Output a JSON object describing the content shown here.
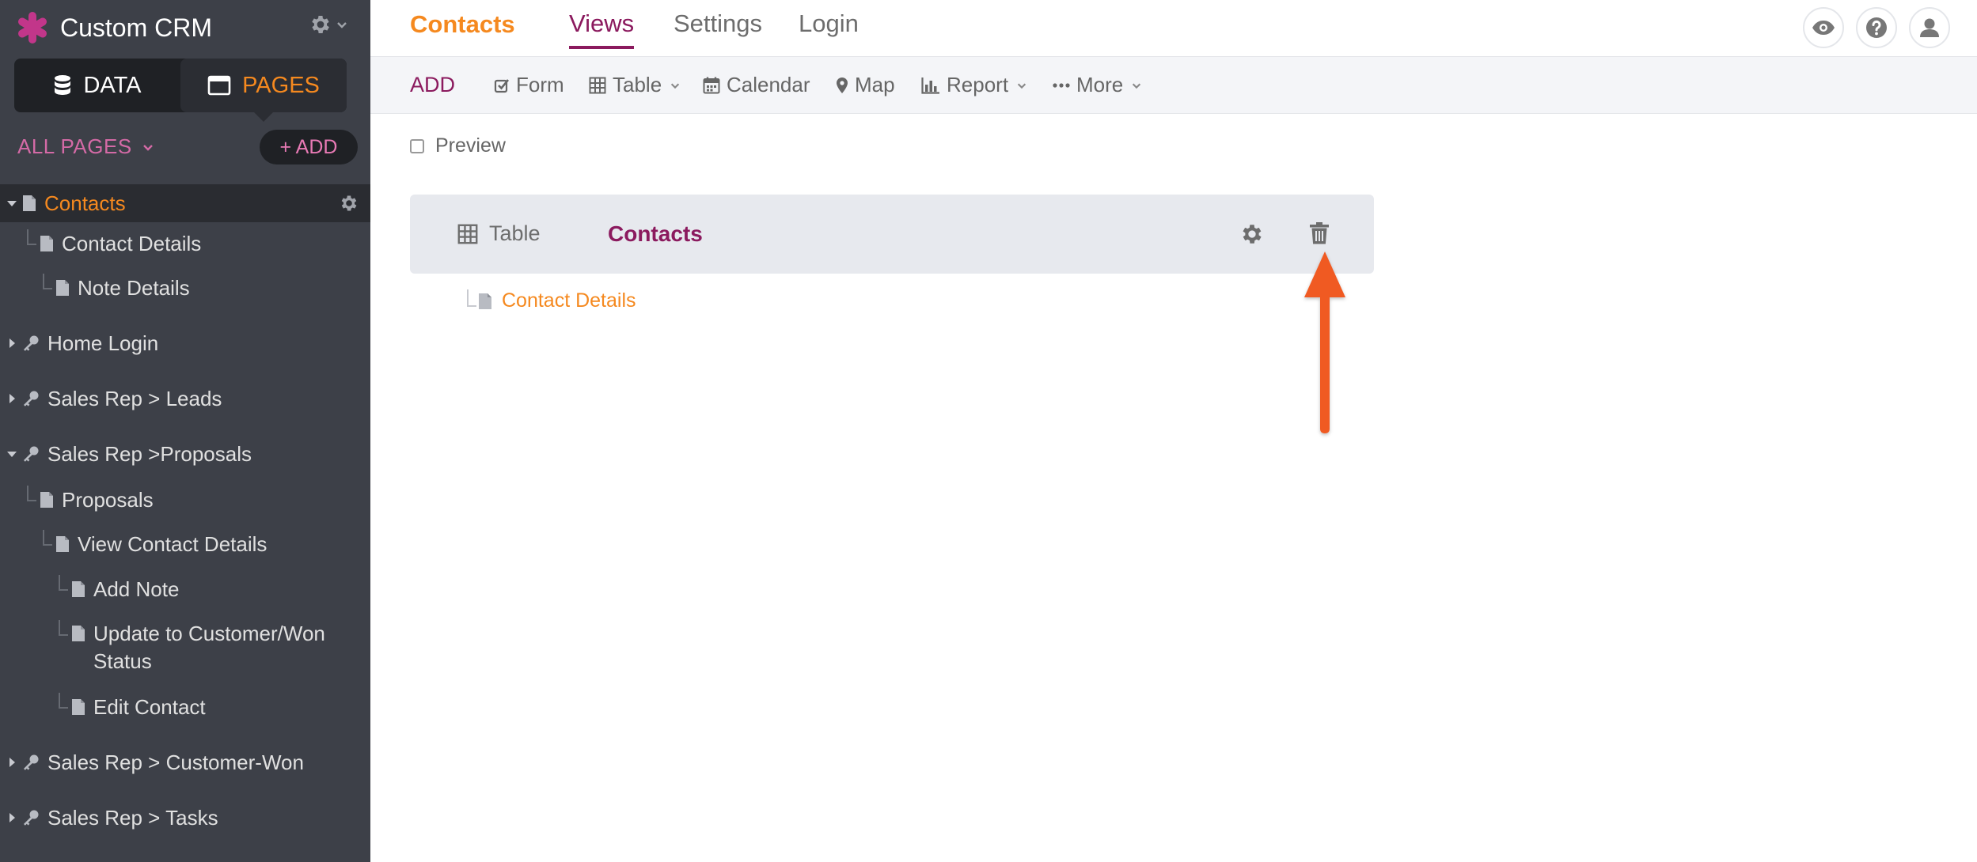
{
  "app": {
    "name": "Custom CRM"
  },
  "modes": [
    {
      "label": "DATA",
      "icon": "database-icon",
      "active": false
    },
    {
      "label": "PAGES",
      "icon": "window-icon",
      "active": true
    }
  ],
  "pages_header": {
    "filter_label": "ALL PAGES",
    "add_label": "+ ADD"
  },
  "tree": [
    {
      "label": "Contacts",
      "icon": "document-icon",
      "expanded": true,
      "selected": true
    },
    {
      "label": "Contact Details",
      "icon": "document-icon"
    },
    {
      "label": "Note Details",
      "icon": "document-icon"
    },
    {
      "label": "Home Login",
      "icon": "key-icon",
      "expanded": false
    },
    {
      "label": "Sales Rep > Leads",
      "icon": "key-icon",
      "expanded": false
    },
    {
      "label": "Sales Rep >Proposals",
      "icon": "key-icon",
      "expanded": true
    },
    {
      "label": "Proposals",
      "icon": "document-icon"
    },
    {
      "label": "View Contact Details",
      "icon": "document-icon"
    },
    {
      "label": "Add Note",
      "icon": "document-icon"
    },
    {
      "label": "Update to Customer/Won Status",
      "icon": "document-icon"
    },
    {
      "label": "Edit Contact",
      "icon": "document-icon"
    },
    {
      "label": "Sales Rep > Customer-Won",
      "icon": "key-icon",
      "expanded": false
    },
    {
      "label": "Sales Rep > Tasks",
      "icon": "key-icon",
      "expanded": false
    }
  ],
  "topnav": {
    "page_name": "Contacts",
    "tabs": [
      {
        "label": "Views",
        "active": true
      },
      {
        "label": "Settings",
        "active": false
      },
      {
        "label": "Login",
        "active": false
      }
    ],
    "icons": [
      "eye-icon",
      "help-icon",
      "user-icon"
    ]
  },
  "toolbar": {
    "add_label": "ADD",
    "items": [
      {
        "label": "Form",
        "icon": "checkbox-icon"
      },
      {
        "label": "Table",
        "icon": "table-icon",
        "dropdown": true
      },
      {
        "label": "Calendar",
        "icon": "calendar-icon"
      },
      {
        "label": "Map",
        "icon": "map-pin-icon"
      },
      {
        "label": "Report",
        "icon": "bar-chart-icon",
        "dropdown": true
      },
      {
        "label": "More",
        "icon": "ellipsis-icon",
        "dropdown": true
      }
    ]
  },
  "content": {
    "preview_label": "Preview",
    "view": {
      "type_label": "Table",
      "title": "Contacts"
    },
    "child_link": "Contact Details"
  },
  "colors": {
    "accent_orange": "#f5891f",
    "accent_purple": "#8b1a5e",
    "sidebar_bg": "#3d4048",
    "annotation_arrow": "#f05a22"
  }
}
